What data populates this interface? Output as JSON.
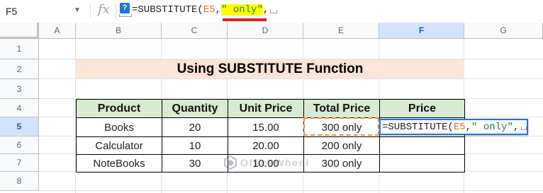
{
  "formula_bar": {
    "cell_ref": "F5",
    "fx_label": "fx",
    "help_icon": "?",
    "formula_prefix": "=SUBSTITUTE(",
    "formula_ref": "E5",
    "formula_comma": ",",
    "formula_highlight": "\" only\"",
    "formula_suffix": ","
  },
  "columns": [
    "A",
    "B",
    "C",
    "D",
    "E",
    "F",
    "G"
  ],
  "rows": [
    "1",
    "2",
    "3",
    "4",
    "5",
    "6",
    "7",
    "8"
  ],
  "selected_column": "F",
  "selected_row": "5",
  "title": "Using SUBSTITUTE Function",
  "table": {
    "headers": [
      "Product",
      "Quantity",
      "Unit Price",
      "Total Price",
      "Price"
    ],
    "rows": [
      [
        "Books",
        "20",
        "15.00",
        "300 only",
        ""
      ],
      [
        "Calculator",
        "10",
        "20.00",
        "200 only",
        ""
      ],
      [
        "NoteBooks",
        "30",
        "10.00",
        "300 only",
        ""
      ]
    ]
  },
  "editor": {
    "prefix": "=SUBSTITUTE(",
    "ref": "E5",
    "comma1": ",",
    "str": "\" only\"",
    "comma2": ","
  },
  "watermark": "OfficeWheel",
  "colors": {
    "title_bg": "#fce4d6",
    "header_bg": "#d9ead3",
    "highlight": "#ffff00",
    "ref_color": "#c5792e",
    "string_color": "#188038",
    "selection_blue": "#1a73e8"
  }
}
